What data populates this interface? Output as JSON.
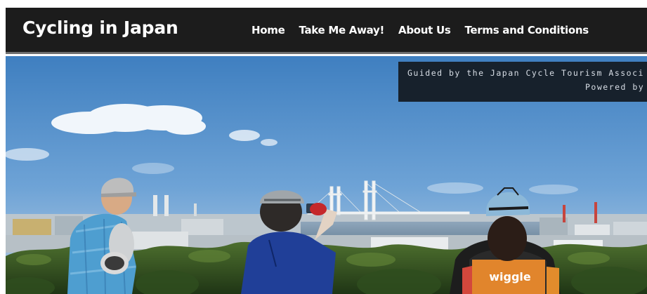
{
  "header": {
    "brand": "Cycling in Japan",
    "nav": [
      {
        "label": "Home"
      },
      {
        "label": "Take Me Away!"
      },
      {
        "label": "About Us"
      },
      {
        "label": "Terms and Conditions"
      }
    ]
  },
  "banner": {
    "line1": "Guided by the Japan Cycle Tourism Associ",
    "line2": "Powered by"
  },
  "hero": {
    "jersey_text": "wiggle"
  },
  "colors": {
    "navbar_bg": "#1c1c1c",
    "banner_bg": "#17212c",
    "sky": "#5b94c8"
  }
}
